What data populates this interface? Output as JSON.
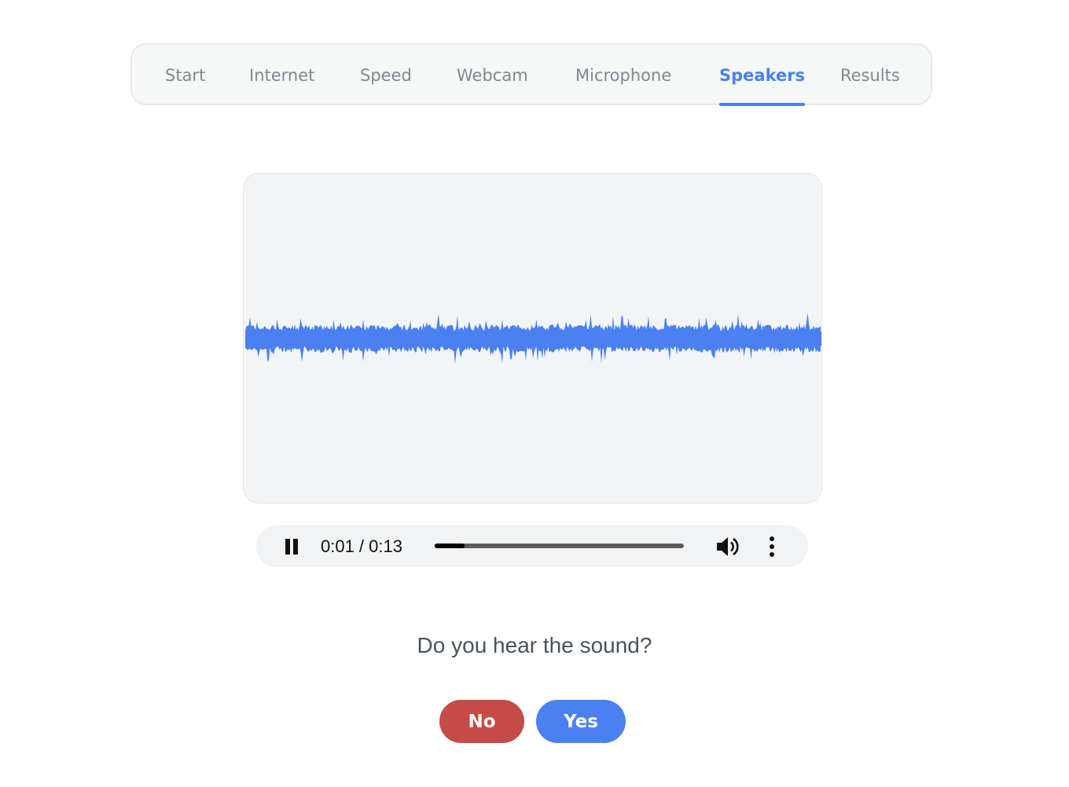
{
  "tabs": [
    {
      "label": "Start",
      "active": false
    },
    {
      "label": "Internet",
      "active": false
    },
    {
      "label": "Speed",
      "active": false
    },
    {
      "label": "Webcam",
      "active": false
    },
    {
      "label": "Microphone",
      "active": false
    },
    {
      "label": "Speakers",
      "active": true
    },
    {
      "label": "Results",
      "active": false
    }
  ],
  "colors": {
    "accent": "#4a80f0",
    "inactive_tab": "#7f8891",
    "no_button": "#c44b48",
    "waveform": "#4a80f0"
  },
  "player": {
    "state": "playing",
    "pause_icon": "pause-icon",
    "time_display": "0:01 / 0:13",
    "progress_fraction": 0.12,
    "volume_icon": "speaker-volume-icon",
    "menu_icon": "vertical-dots-icon"
  },
  "question": {
    "text": "Do you hear the sound?"
  },
  "buttons": {
    "no_label": "No",
    "yes_label": "Yes"
  }
}
